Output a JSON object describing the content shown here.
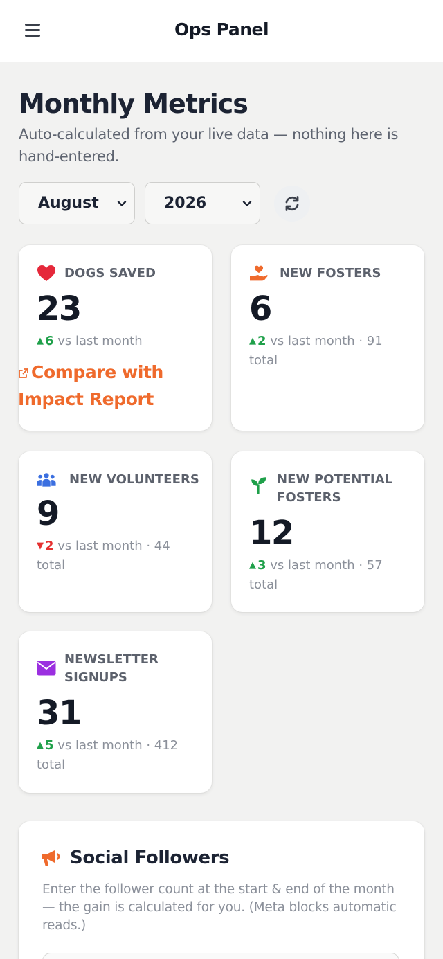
{
  "header": {
    "app_title": "Ops Panel",
    "menu_icon": "hamburger-menu-icon"
  },
  "page": {
    "title": "Monthly Metrics",
    "subtitle": "Auto-calculated from your live data — nothing here is hand-entered."
  },
  "filters": {
    "month": "August",
    "year": "2026",
    "refresh_icon": "refresh-icon"
  },
  "metrics": {
    "dogs_saved": {
      "icon": "heart-icon",
      "icon_color": "#e5283a",
      "label": "DOGS SAVED",
      "value": "23",
      "delta_dir": "up",
      "delta": "6",
      "delta_text": " vs last month",
      "link": "Compare with Impact Report",
      "link_icon": "external-link-icon"
    },
    "new_fosters": {
      "icon": "hand-heart-icon",
      "icon_color": "#ef6a2c",
      "label": "NEW FOSTERS",
      "value": "6",
      "delta_dir": "up",
      "delta": "2",
      "delta_text": " vs last month · 91 total"
    },
    "new_volunteers": {
      "icon": "people-group-icon",
      "icon_color": "#3b6fe0",
      "label": "NEW VOLUNTEERS",
      "value": "9",
      "delta_dir": "down",
      "delta": "2",
      "delta_text": " vs last month · 44 total"
    },
    "new_potential_fosters": {
      "icon": "seedling-icon",
      "icon_color": "#1fa04a",
      "label": "NEW POTENTIAL FOSTERS",
      "value": "12",
      "delta_dir": "up",
      "delta": "3",
      "delta_text": " vs last month · 57 total"
    },
    "newsletter_signups": {
      "icon": "envelope-icon",
      "icon_color": "#9b2fe0",
      "label": "NEWSLETTER SIGNUPS",
      "value": "31",
      "delta_dir": "up",
      "delta": "5",
      "delta_text": " vs last month · 412 total"
    }
  },
  "social": {
    "icon": "megaphone-icon",
    "icon_color": "#ef6a2c",
    "title": "Social Followers",
    "description": "Enter the follower count at the start & end of the month — the gain is calculated for you. (Meta blocks automatic reads.)"
  },
  "colors": {
    "accent": "#ef6a2c",
    "up": "#1fa04a",
    "down": "#e53030"
  }
}
